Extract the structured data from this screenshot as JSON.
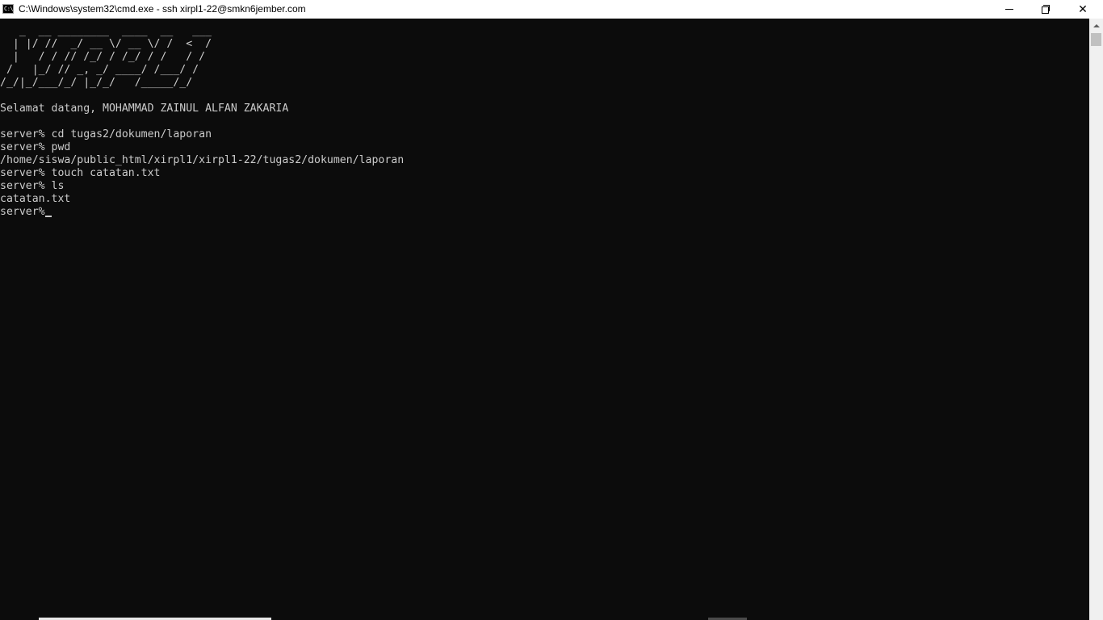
{
  "window": {
    "title": "C:\\Windows\\system32\\cmd.exe - ssh  xirpl1-22@smkn6jember.com",
    "app_icon_glyph": "C:\\",
    "icons": {
      "app": "cmd-icon",
      "minimize": "minimize-icon",
      "restore": "restore-icon",
      "close": "close-icon",
      "scroll_up": "arrow-up-icon"
    },
    "close_glyph": "✕"
  },
  "console": {
    "colors": {
      "background": "#0c0c0c",
      "foreground": "#cccccc"
    },
    "banner": [
      "   _  __ ________  ____  __   ___",
      "  | |/ //  _/ __ \\/ __ \\/ /  <  /",
      "  |   / / // /_/ / /_/ / /   / / ",
      " /   |_/ // _, _/ ____/ /___/ /  ",
      "/_/|_/___/_/ |_/_/   /_____/_/   "
    ],
    "welcome": "Selamat datang, MOHAMMAD ZAINUL ALFAN ZAKARIA",
    "session": [
      "server% cd tugas2/dokumen/laporan",
      "server% pwd",
      "/home/siswa/public_html/xirpl1/xirpl1-22/tugas2/dokumen/laporan",
      "server% touch catatan.txt",
      "server% ls",
      "catatan.txt"
    ],
    "prompt": "server%"
  }
}
